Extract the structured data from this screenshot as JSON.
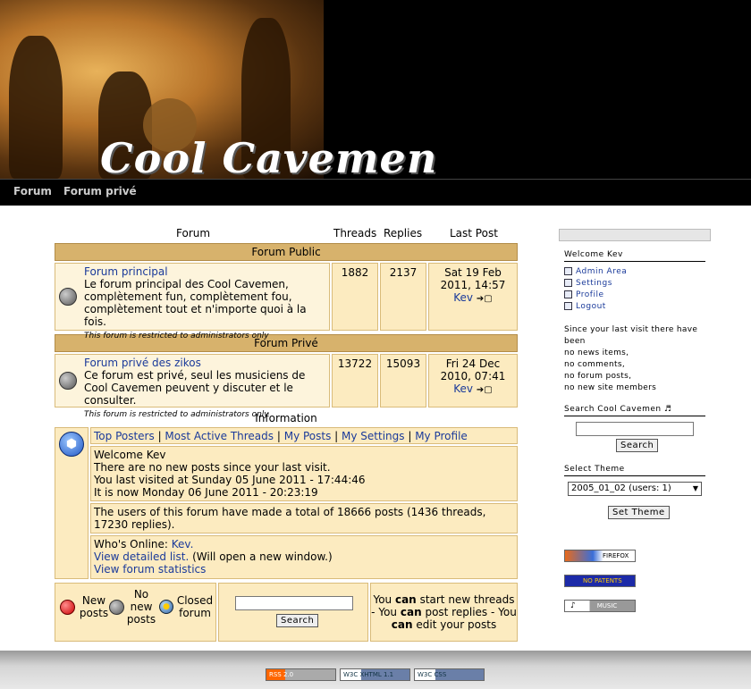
{
  "site": {
    "title": "Cool Cavemen"
  },
  "nav": {
    "items": [
      "Forum",
      "Forum privé"
    ]
  },
  "columns": {
    "forum": "Forum",
    "threads": "Threads",
    "replies": "Replies",
    "last_post": "Last Post"
  },
  "categories": [
    {
      "name": "Forum Public",
      "forum": {
        "title": "Forum principal",
        "description": "Le forum principal des Cool Cavemen, complètement fun, complètement fou, complètement tout et n'importe quoi à la fois.",
        "note": "This forum is restricted to administrators only",
        "threads": "1882",
        "replies": "2137",
        "last_date": "Sat 19 Feb 2011, 14:57",
        "last_user": "Kev"
      }
    },
    {
      "name": "Forum Privé",
      "forum": {
        "title": "Forum privé des zikos",
        "description": "Ce forum est privé, seul les musiciens de Cool Cavemen peuvent y discuter et le consulter.",
        "note": "This forum is restricted to administrators only",
        "threads": "13722",
        "replies": "15093",
        "last_date": "Fri 24 Dec 2010, 07:41",
        "last_user": "Kev"
      }
    }
  ],
  "information": {
    "title": "Information",
    "links": [
      "Top Posters",
      "Most Active Threads",
      "My Posts",
      "My Settings",
      "My Profile"
    ],
    "welcome": "Welcome Kev",
    "no_new": "There are no new posts since your last visit.",
    "last_visited": "You last visited at Sunday 05 June 2011 - 17:44:46",
    "now": "It is now Monday 06 June 2011 - 20:23:19",
    "stats": "The users of this forum have made a total of 18666 posts (1436 threads, 17230 replies).",
    "whos_online_label": "Who's Online:",
    "whos_online_user": "Kev.",
    "detailed_list": "View detailed list.",
    "detailed_note": "(Will open a new window.)",
    "statistics": "View forum statistics"
  },
  "legend": {
    "new": "New posts",
    "no_new": "No new posts",
    "closed": "Closed forum"
  },
  "bottom_search": {
    "button": "Search"
  },
  "permissions": {
    "you": "You",
    "can": "can",
    "threads": "start new threads -",
    "replies": "post replies - You",
    "edit": "edit your posts"
  },
  "sidebar": {
    "welcome": "Welcome Kev",
    "links": [
      "Admin Area",
      "Settings",
      "Profile",
      "Logout"
    ],
    "since_visit": "Since your last visit there have been",
    "stats": [
      "no news items,",
      "no comments,",
      "no forum posts,",
      "no new site members"
    ],
    "search_title": "Search Cool Cavemen",
    "search_button": "Search",
    "theme_title": "Select Theme",
    "theme_selected": "2005_01_02 (users: 1)",
    "theme_button": "Set Theme",
    "badges": [
      "FIREFOX",
      "NO PATENTS",
      "MUSIC"
    ]
  },
  "footer": {
    "badges": [
      "RSS 2.0",
      "W3C XHTML 1.1",
      "W3C CSS"
    ]
  }
}
